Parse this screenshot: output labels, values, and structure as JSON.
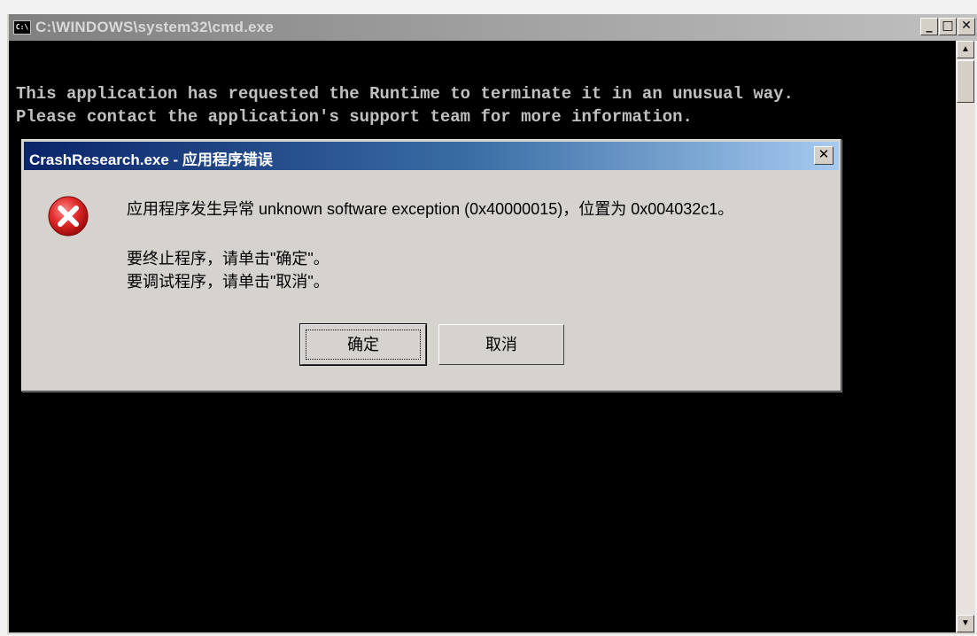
{
  "cmd_window": {
    "title": "C:\\WINDOWS\\system32\\cmd.exe",
    "icon_text": "C:\\",
    "minimize_label": "_",
    "maximize_label": "□",
    "close_label": "✕",
    "lines": [
      "This application has requested the Runtime to terminate it in an unusual way.",
      "Please contact the application's support team for more information."
    ]
  },
  "dialog": {
    "title": "CrashResearch.exe - 应用程序错误",
    "close_label": "✕",
    "message": "应用程序发生异常 unknown software exception (0x40000015)，位置为 0x004032c1。",
    "instruction_ok": "要终止程序，请单击\"确定\"。",
    "instruction_cancel": "要调试程序，请单击\"取消\"。",
    "ok_label": "确定",
    "cancel_label": "取消"
  },
  "icons": {
    "error": "error-icon",
    "scroll_up": "scroll-up-arrow-icon",
    "scroll_down": "scroll-down-arrow-icon"
  },
  "colors": {
    "cmd_background": "#000000",
    "cmd_text": "#c0c0c0",
    "dialog_background": "#d6d3ce",
    "dialog_titlebar_start": "#0a246a",
    "dialog_titlebar_end": "#a6caf0",
    "error_red": "#d21f1f"
  }
}
